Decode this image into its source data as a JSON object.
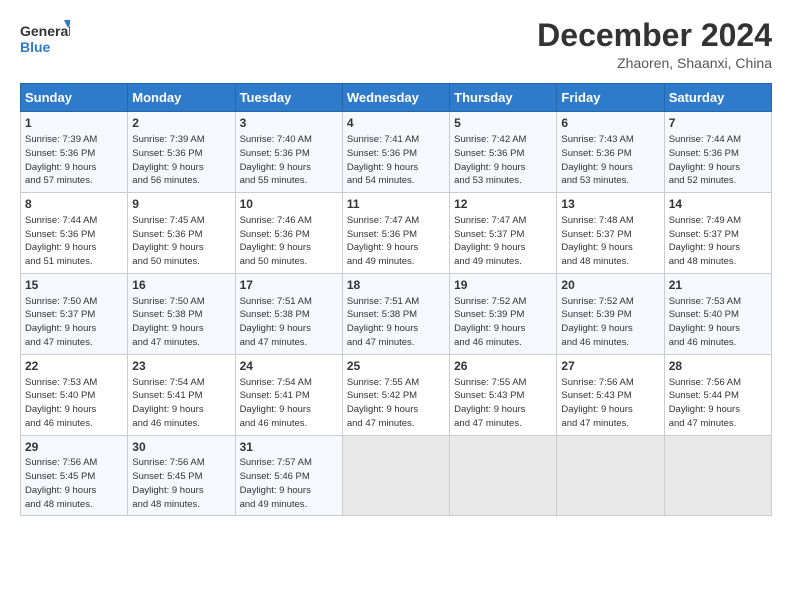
{
  "header": {
    "logo_general": "General",
    "logo_blue": "Blue",
    "month_title": "December 2024",
    "location": "Zhaoren, Shaanxi, China"
  },
  "days_of_week": [
    "Sunday",
    "Monday",
    "Tuesday",
    "Wednesday",
    "Thursday",
    "Friday",
    "Saturday"
  ],
  "weeks": [
    [
      {
        "day": "1",
        "info": "Sunrise: 7:39 AM\nSunset: 5:36 PM\nDaylight: 9 hours\nand 57 minutes."
      },
      {
        "day": "2",
        "info": "Sunrise: 7:39 AM\nSunset: 5:36 PM\nDaylight: 9 hours\nand 56 minutes."
      },
      {
        "day": "3",
        "info": "Sunrise: 7:40 AM\nSunset: 5:36 PM\nDaylight: 9 hours\nand 55 minutes."
      },
      {
        "day": "4",
        "info": "Sunrise: 7:41 AM\nSunset: 5:36 PM\nDaylight: 9 hours\nand 54 minutes."
      },
      {
        "day": "5",
        "info": "Sunrise: 7:42 AM\nSunset: 5:36 PM\nDaylight: 9 hours\nand 53 minutes."
      },
      {
        "day": "6",
        "info": "Sunrise: 7:43 AM\nSunset: 5:36 PM\nDaylight: 9 hours\nand 53 minutes."
      },
      {
        "day": "7",
        "info": "Sunrise: 7:44 AM\nSunset: 5:36 PM\nDaylight: 9 hours\nand 52 minutes."
      }
    ],
    [
      {
        "day": "8",
        "info": "Sunrise: 7:44 AM\nSunset: 5:36 PM\nDaylight: 9 hours\nand 51 minutes."
      },
      {
        "day": "9",
        "info": "Sunrise: 7:45 AM\nSunset: 5:36 PM\nDaylight: 9 hours\nand 50 minutes."
      },
      {
        "day": "10",
        "info": "Sunrise: 7:46 AM\nSunset: 5:36 PM\nDaylight: 9 hours\nand 50 minutes."
      },
      {
        "day": "11",
        "info": "Sunrise: 7:47 AM\nSunset: 5:36 PM\nDaylight: 9 hours\nand 49 minutes."
      },
      {
        "day": "12",
        "info": "Sunrise: 7:47 AM\nSunset: 5:37 PM\nDaylight: 9 hours\nand 49 minutes."
      },
      {
        "day": "13",
        "info": "Sunrise: 7:48 AM\nSunset: 5:37 PM\nDaylight: 9 hours\nand 48 minutes."
      },
      {
        "day": "14",
        "info": "Sunrise: 7:49 AM\nSunset: 5:37 PM\nDaylight: 9 hours\nand 48 minutes."
      }
    ],
    [
      {
        "day": "15",
        "info": "Sunrise: 7:50 AM\nSunset: 5:37 PM\nDaylight: 9 hours\nand 47 minutes."
      },
      {
        "day": "16",
        "info": "Sunrise: 7:50 AM\nSunset: 5:38 PM\nDaylight: 9 hours\nand 47 minutes."
      },
      {
        "day": "17",
        "info": "Sunrise: 7:51 AM\nSunset: 5:38 PM\nDaylight: 9 hours\nand 47 minutes."
      },
      {
        "day": "18",
        "info": "Sunrise: 7:51 AM\nSunset: 5:38 PM\nDaylight: 9 hours\nand 47 minutes."
      },
      {
        "day": "19",
        "info": "Sunrise: 7:52 AM\nSunset: 5:39 PM\nDaylight: 9 hours\nand 46 minutes."
      },
      {
        "day": "20",
        "info": "Sunrise: 7:52 AM\nSunset: 5:39 PM\nDaylight: 9 hours\nand 46 minutes."
      },
      {
        "day": "21",
        "info": "Sunrise: 7:53 AM\nSunset: 5:40 PM\nDaylight: 9 hours\nand 46 minutes."
      }
    ],
    [
      {
        "day": "22",
        "info": "Sunrise: 7:53 AM\nSunset: 5:40 PM\nDaylight: 9 hours\nand 46 minutes."
      },
      {
        "day": "23",
        "info": "Sunrise: 7:54 AM\nSunset: 5:41 PM\nDaylight: 9 hours\nand 46 minutes."
      },
      {
        "day": "24",
        "info": "Sunrise: 7:54 AM\nSunset: 5:41 PM\nDaylight: 9 hours\nand 46 minutes."
      },
      {
        "day": "25",
        "info": "Sunrise: 7:55 AM\nSunset: 5:42 PM\nDaylight: 9 hours\nand 47 minutes."
      },
      {
        "day": "26",
        "info": "Sunrise: 7:55 AM\nSunset: 5:43 PM\nDaylight: 9 hours\nand 47 minutes."
      },
      {
        "day": "27",
        "info": "Sunrise: 7:56 AM\nSunset: 5:43 PM\nDaylight: 9 hours\nand 47 minutes."
      },
      {
        "day": "28",
        "info": "Sunrise: 7:56 AM\nSunset: 5:44 PM\nDaylight: 9 hours\nand 47 minutes."
      }
    ],
    [
      {
        "day": "29",
        "info": "Sunrise: 7:56 AM\nSunset: 5:45 PM\nDaylight: 9 hours\nand 48 minutes."
      },
      {
        "day": "30",
        "info": "Sunrise: 7:56 AM\nSunset: 5:45 PM\nDaylight: 9 hours\nand 48 minutes."
      },
      {
        "day": "31",
        "info": "Sunrise: 7:57 AM\nSunset: 5:46 PM\nDaylight: 9 hours\nand 49 minutes."
      },
      {
        "day": "",
        "info": ""
      },
      {
        "day": "",
        "info": ""
      },
      {
        "day": "",
        "info": ""
      },
      {
        "day": "",
        "info": ""
      }
    ]
  ]
}
